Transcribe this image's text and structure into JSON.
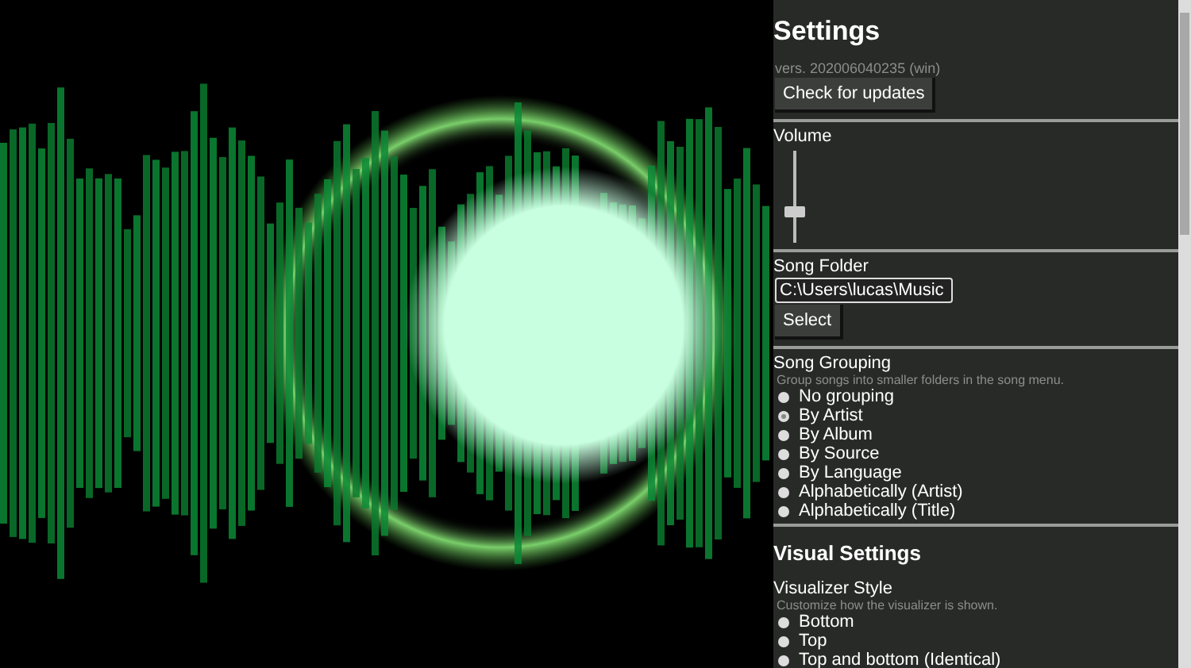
{
  "settings": {
    "title": "Settings",
    "version": "vers. 202006040235 (win)",
    "update_button": "Check for updates"
  },
  "volume": {
    "label": "Volume",
    "level": 0.35
  },
  "song_folder": {
    "label": "Song Folder",
    "value": "C:\\Users\\lucas\\Music",
    "button": "Select"
  },
  "song_grouping": {
    "label": "Song Grouping",
    "hint": "Group songs into smaller folders in the song menu.",
    "options": [
      {
        "label": "No grouping",
        "selected": false
      },
      {
        "label": "By Artist",
        "selected": true
      },
      {
        "label": "By Album",
        "selected": false
      },
      {
        "label": "By Source",
        "selected": false
      },
      {
        "label": "By Language",
        "selected": false
      },
      {
        "label": "Alphabetically (Artist)",
        "selected": false
      },
      {
        "label": "Alphabetically (Title)",
        "selected": false
      }
    ]
  },
  "visual_settings": {
    "title": "Visual Settings",
    "visualizer_style": {
      "label": "Visualizer Style",
      "hint": "Customize how the visualizer is shown.",
      "options": [
        {
          "label": "Bottom",
          "selected": false
        },
        {
          "label": "Top",
          "selected": false
        },
        {
          "label": "Top and bottom (Identical)",
          "selected": false
        }
      ]
    }
  }
}
